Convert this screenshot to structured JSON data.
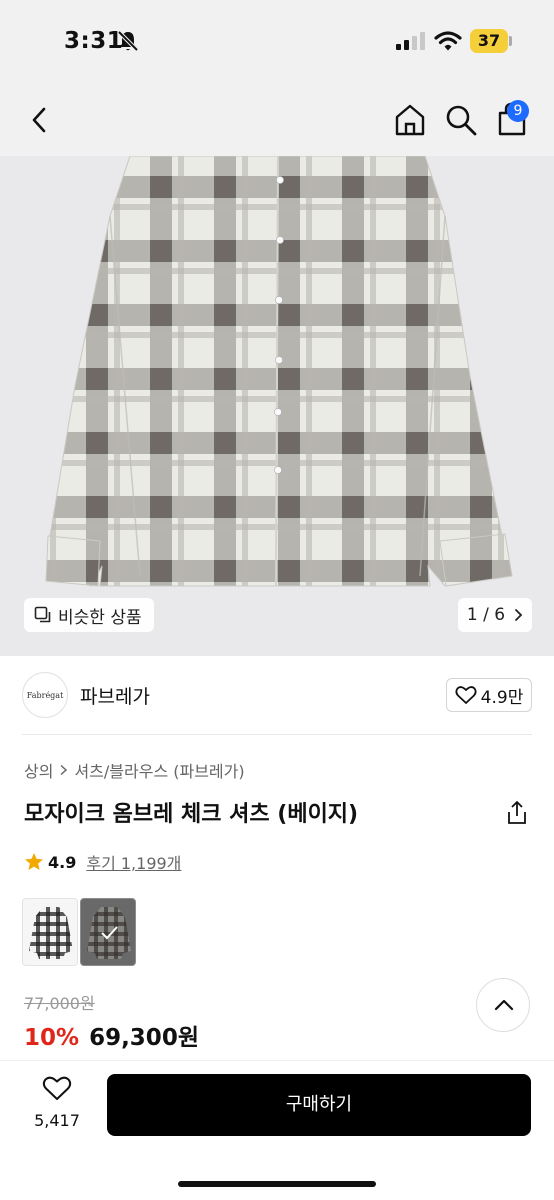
{
  "status_bar": {
    "time": "3:31",
    "battery": "37"
  },
  "nav": {
    "cart_count": "9"
  },
  "gallery": {
    "similar_label": "비슷한 상품",
    "page_indicator": "1 / 6"
  },
  "brand": {
    "logo_text": "Fabrégat",
    "name": "파브레가",
    "likes": "4.9만"
  },
  "breadcrumb": [
    "상의",
    "셔츠/블라우스 (파브레가)"
  ],
  "product": {
    "title": "모자이크 옴브레 체크 셔츠 (베이지)",
    "rating": "4.9",
    "reviews": "후기 1,199개",
    "original_price": "77,000원",
    "discount": "10%",
    "price": "69,300원"
  },
  "bottom": {
    "heart_count": "5,417",
    "buy_label": "구매하기"
  }
}
